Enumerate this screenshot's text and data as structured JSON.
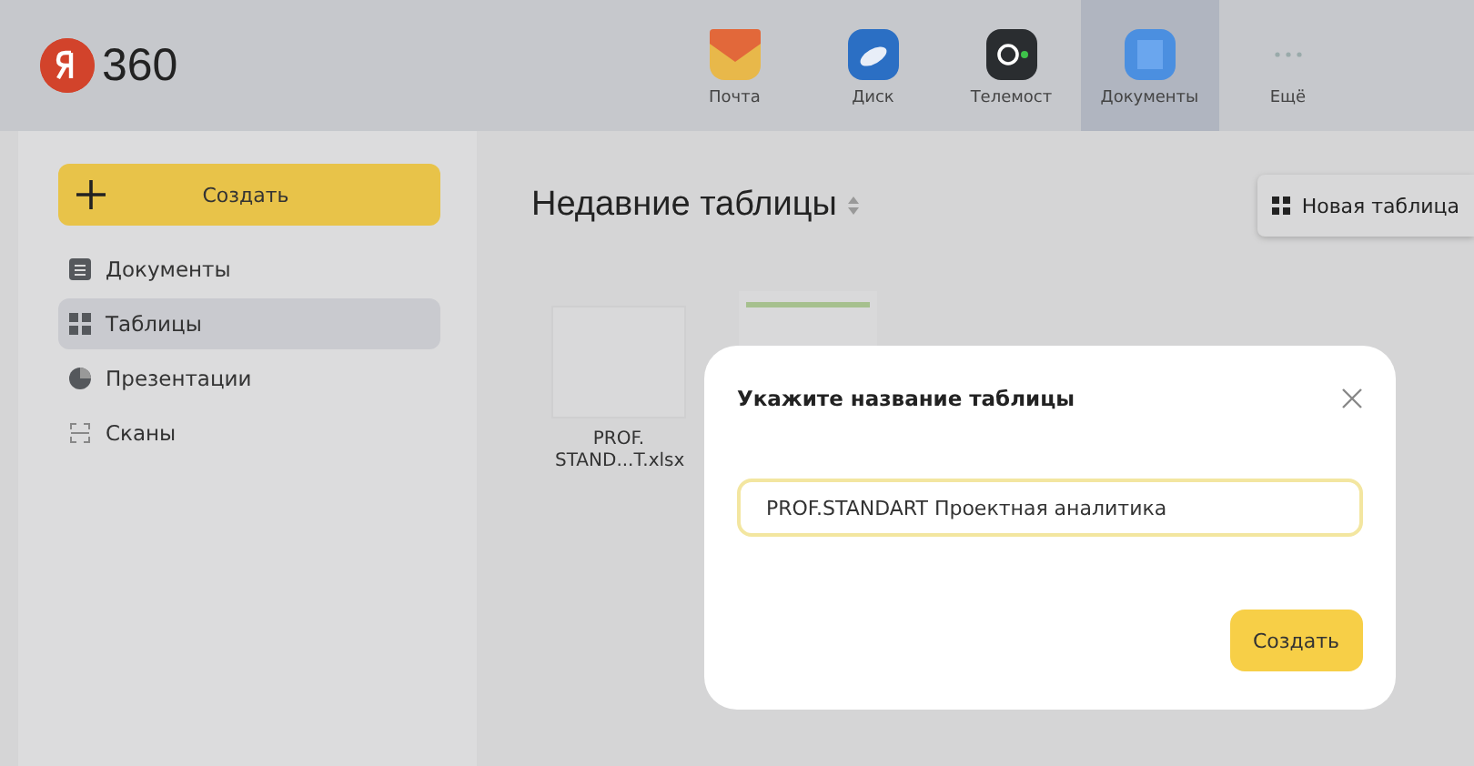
{
  "header": {
    "logo": "360",
    "services": [
      {
        "label": "Почта",
        "kind": "mail",
        "selected": false
      },
      {
        "label": "Диск",
        "kind": "disk",
        "selected": false
      },
      {
        "label": "Телемост",
        "kind": "telemost",
        "selected": false
      },
      {
        "label": "Документы",
        "kind": "docs",
        "selected": true
      },
      {
        "label": "Ещё",
        "kind": "more",
        "selected": false
      }
    ]
  },
  "sidebar": {
    "create_button": "Создать",
    "items": [
      {
        "label": "Документы",
        "kind": "docs",
        "selected": false
      },
      {
        "label": "Таблицы",
        "kind": "sheets",
        "selected": true
      },
      {
        "label": "Презентации",
        "kind": "slides",
        "selected": false
      },
      {
        "label": "Сканы",
        "kind": "scans",
        "selected": false
      }
    ]
  },
  "main": {
    "title": "Недавние таблицы",
    "new_button": "Новая таблица",
    "files": [
      {
        "name": "PROF. STAND...T.xlsx",
        "kind": "blank"
      },
      {
        "kind": "sheet"
      }
    ]
  },
  "dialog": {
    "title": "Укажите название таблицы",
    "value": "PROF.STANDART Проектная аналитика",
    "submit": "Создать"
  }
}
